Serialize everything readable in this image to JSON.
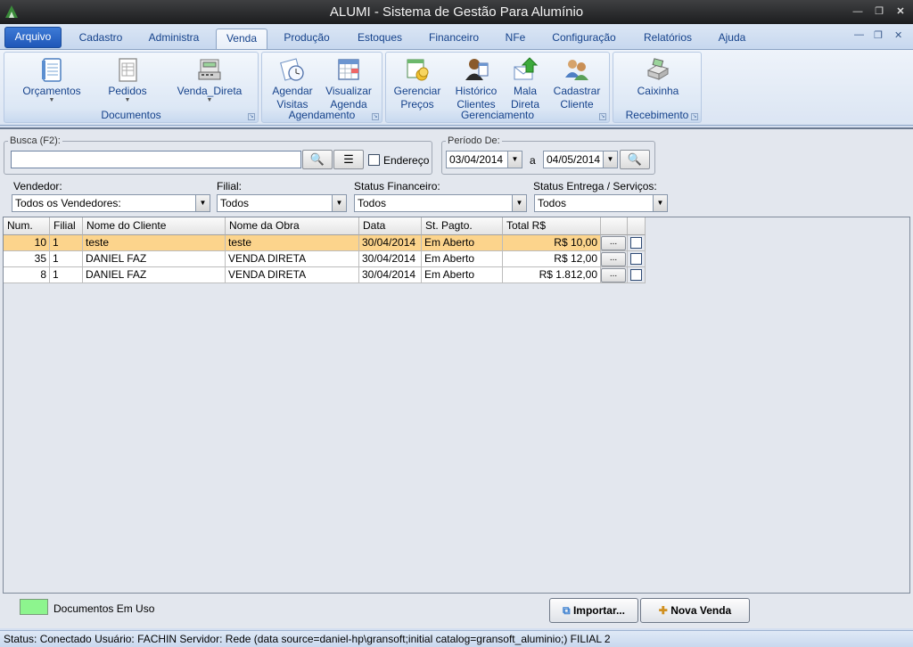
{
  "window": {
    "title": "ALUMI - Sistema de Gestão Para Alumínio"
  },
  "menu_tabs": [
    "Arquivo",
    "Cadastro",
    "Administra",
    "Venda",
    "Produção",
    "Estoques",
    "Financeiro",
    "NFe",
    "Configuração",
    "Relatórios",
    "Ajuda"
  ],
  "active_tab": "Venda",
  "ribbon": {
    "groups": {
      "documentos": {
        "label": "Documentos",
        "buttons": [
          "Orçamentos",
          "Pedidos",
          "Venda_Direta"
        ]
      },
      "agendamento": {
        "label": "Agendamento",
        "buttons": [
          [
            "Agendar",
            "Visitas"
          ],
          [
            "Visualizar",
            "Agenda"
          ]
        ]
      },
      "gerenciamento": {
        "label": "Gerenciamento",
        "buttons": [
          [
            "Gerenciar",
            "Preços"
          ],
          [
            "Histórico",
            "Clientes"
          ],
          [
            "Mala",
            "Direta"
          ],
          [
            "Cadastrar",
            "Cliente"
          ]
        ]
      },
      "recebimento": {
        "label": "Recebimento",
        "buttons": [
          "Caixinha"
        ]
      }
    }
  },
  "search": {
    "legend": "Busca (F2):",
    "value": "",
    "endereco_label": "Endereço",
    "endereco_checked": false
  },
  "periodo": {
    "legend": "Período De:",
    "from": "03/04/2014",
    "sep": "a",
    "to": "04/05/2014"
  },
  "filters": {
    "vendedor": {
      "label": "Vendedor:",
      "value": "Todos os Vendedores:"
    },
    "filial": {
      "label": "Filial:",
      "value": "Todos"
    },
    "status_fin": {
      "label": "Status Financeiro:",
      "value": "Todos"
    },
    "status_ent": {
      "label": "Status Entrega / Serviços:",
      "value": "Todos"
    }
  },
  "table": {
    "columns": [
      "Num.",
      "Filial",
      "Nome do Cliente",
      "Nome da Obra",
      "Data",
      "St. Pagto.",
      "Total R$"
    ],
    "rows": [
      {
        "num": "10",
        "filial": "1",
        "cliente": "teste",
        "obra": "teste",
        "data": "30/04/2014",
        "status": "Em Aberto",
        "total": "R$ 10,00",
        "selected": true
      },
      {
        "num": "35",
        "filial": "1",
        "cliente": "DANIEL FAZ",
        "obra": "VENDA DIRETA",
        "data": "30/04/2014",
        "status": "Em Aberto",
        "total": "R$ 12,00",
        "selected": false
      },
      {
        "num": "8",
        "filial": "1",
        "cliente": "DANIEL FAZ",
        "obra": "VENDA DIRETA",
        "data": "30/04/2014",
        "status": "Em Aberto",
        "total": "R$ 1.812,00",
        "selected": false
      }
    ],
    "row_button": "..."
  },
  "legend_text": "Documentos Em Uso",
  "buttons": {
    "importar": "Importar...",
    "nova_venda": "Nova Venda"
  },
  "statusbar": "Status: Conectado   Usuário: FACHIN  Servidor: Rede (data source=daniel-hp\\gransoft;initial catalog=gransoft_aluminio;)   FILIAL 2",
  "colors": {
    "selected_row": "#fcd48c",
    "legend_swatch": "#8df58e",
    "accent": "#15428b"
  }
}
